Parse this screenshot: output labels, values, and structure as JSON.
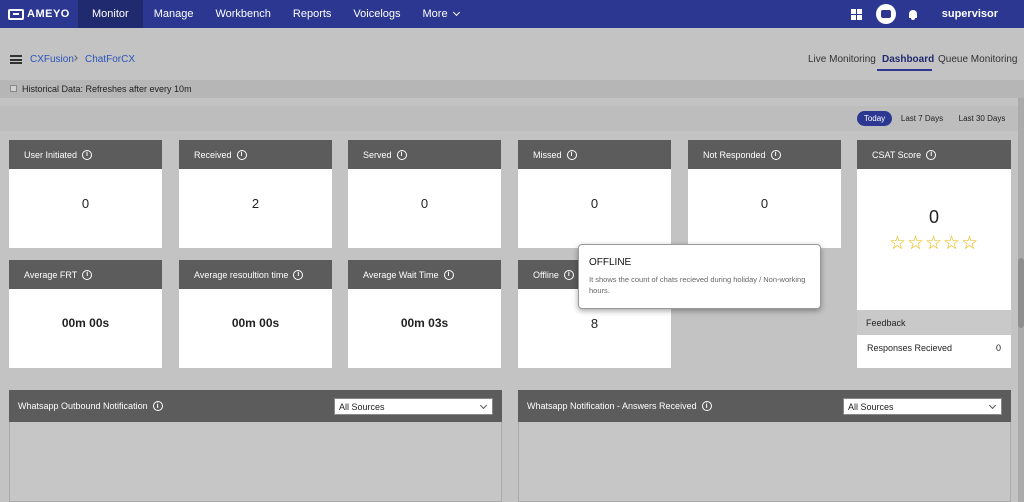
{
  "brand": {
    "logo_text": "AMEYO"
  },
  "nav": {
    "items": [
      {
        "label": "Monitor",
        "active": true
      },
      {
        "label": "Manage"
      },
      {
        "label": "Workbench"
      },
      {
        "label": "Reports"
      },
      {
        "label": "Voicelogs"
      },
      {
        "label": "More"
      }
    ],
    "user": "supervisor"
  },
  "breadcrumb": {
    "items": [
      "CXFusion",
      "ChatForCX"
    ]
  },
  "view_tabs": [
    "Live Monitoring",
    "Dashboard",
    "Queue Monitoring"
  ],
  "active_view_tab": "Dashboard",
  "historical": {
    "label": "Historical Data: Refreshes after every 10m",
    "checked": false
  },
  "ranges": [
    "Today",
    "Last 7 Days",
    "Last 30 Days"
  ],
  "active_range": "Today",
  "info_glyph": "i",
  "metrics_row1": [
    {
      "label": "User Initiated",
      "value": "0"
    },
    {
      "label": "Received",
      "value": "2"
    },
    {
      "label": "Served",
      "value": "0"
    },
    {
      "label": "Missed",
      "value": "0"
    },
    {
      "label": "Not Responded",
      "value": "0"
    }
  ],
  "metrics_row2": [
    {
      "label": "Average FRT",
      "value": "00m 00s"
    },
    {
      "label": "Average resoultion time",
      "value": "00m 00s"
    },
    {
      "label": "Average Wait Time",
      "value": "00m 03s"
    },
    {
      "label": "Offline",
      "value": "8"
    }
  ],
  "csat": {
    "label": "CSAT Score",
    "value": "0",
    "stars": "☆☆☆☆☆",
    "star_count": 5,
    "rating": 0,
    "feedback_label": "Feedback",
    "responses_label": "Responses Recieved",
    "responses_value": "0"
  },
  "panels": [
    {
      "title": "Whatsapp Outbound Notification",
      "select_value": "All Sources"
    },
    {
      "title": "Whatsapp Notification - Answers Received",
      "select_value": "All Sources"
    }
  ],
  "tooltip": {
    "title": "OFFLINE",
    "body": "It shows the count of chats recieved during holiday / Non-working hours."
  },
  "colors": {
    "nav_bg": "#2b3791",
    "nav_active_bg": "#1f2a6f",
    "card_header": "#5c5c5c",
    "page_bg": "#c3c3c3",
    "star": "#e6b800",
    "link": "#2b54b9"
  },
  "icons": [
    "apps-grid-icon",
    "chat-icon",
    "bell-icon",
    "menu-icon",
    "chevron-right-icon",
    "chevron-down-icon",
    "info-icon",
    "star-icon",
    "checkbox-icon"
  ]
}
